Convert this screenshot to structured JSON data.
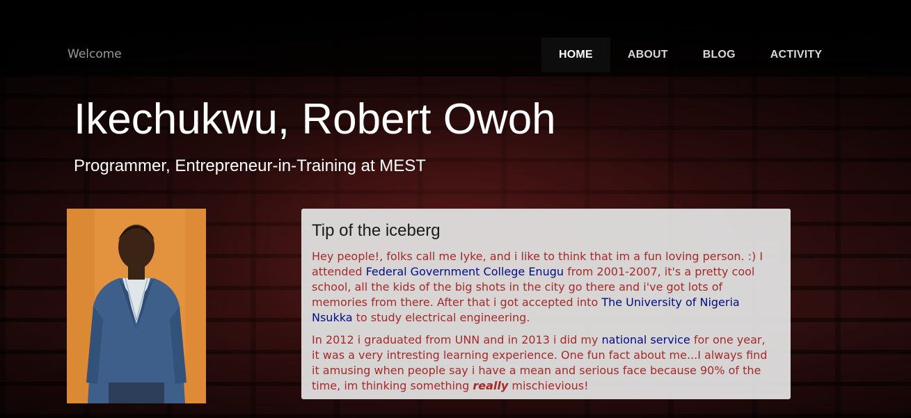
{
  "brand": "Welcome",
  "nav": [
    {
      "label": "HOME",
      "active": true
    },
    {
      "label": "ABOUT",
      "active": false
    },
    {
      "label": "BLOG",
      "active": false
    },
    {
      "label": "ACTIVITY",
      "active": false
    }
  ],
  "hero": {
    "title": "Ikechukwu, Robert Owoh",
    "subtitle": "Programmer, Entrepreneur-in-Training at MEST"
  },
  "card": {
    "title": "Tip of the iceberg",
    "p1": {
      "t1": "Hey people!, folks call me Iyke, and i like to think that im a fun loving person. :) I attended ",
      "link1": "Federal Government College Enugu",
      "t2": " from 2001-2007, it's a pretty cool school, all the kids of the big shots in the city go there and i've got lots of memories from there. After that i got accepted into ",
      "link2": "The University of Nigeria Nsukka",
      "t3": " to study electrical engineering."
    },
    "p2": {
      "t1": "In 2012 i graduated from UNN and in 2013 i did my ",
      "link1": "national service",
      "t2": " for one year, it was a very intresting learning experience. One fun fact about me...I always find it amusing when people say i have a mean and serious face because 90% of the time, im thinking something ",
      "emphasis": "really",
      "t3": " mischievious!"
    }
  },
  "colors": {
    "body_text": "#a52a2a",
    "link": "#000c8a",
    "nav_active_bg": "#0d0d0d"
  }
}
